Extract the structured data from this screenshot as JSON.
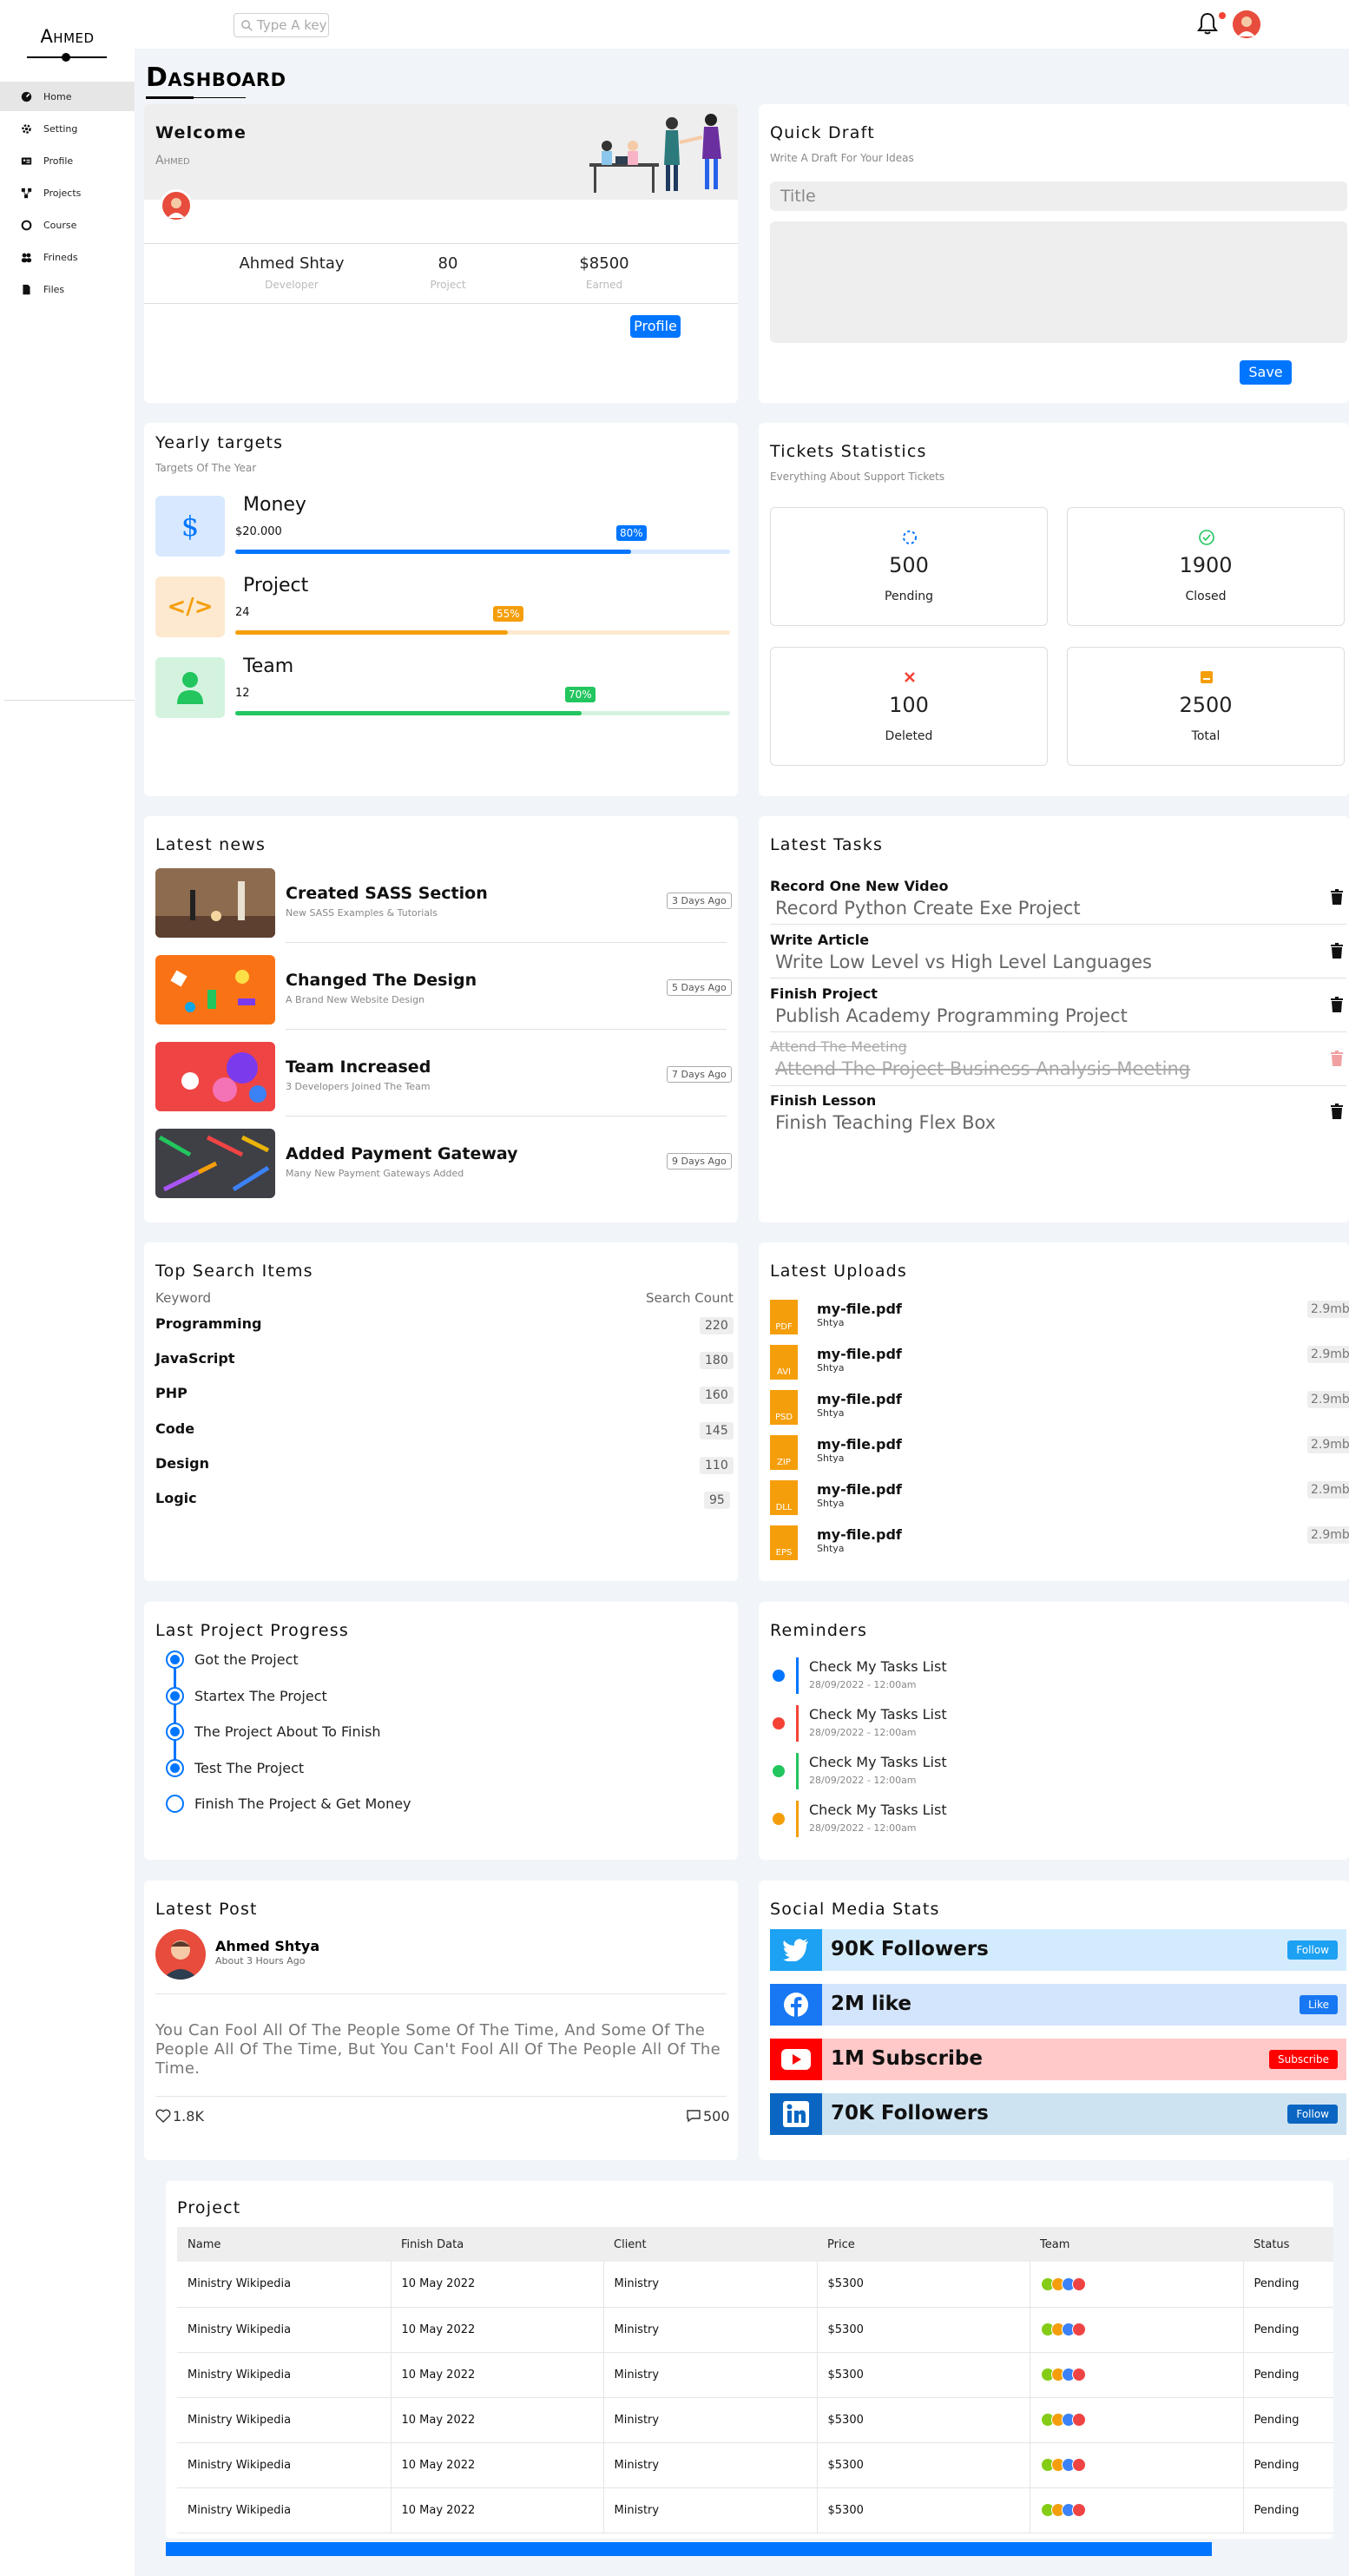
{
  "brand": "Ahmed",
  "sidebar": {
    "items": [
      {
        "label": "Home"
      },
      {
        "label": "Setting"
      },
      {
        "label": "Profile"
      },
      {
        "label": "Projects"
      },
      {
        "label": "Course"
      },
      {
        "label": "Frineds"
      },
      {
        "label": "Files"
      }
    ]
  },
  "header": {
    "search_placeholder": "Type A key"
  },
  "page_title": "Dashboard",
  "welcome": {
    "title": "Welcome",
    "name_small": "Ahmed",
    "stats": [
      {
        "value": "Ahmed Shtay",
        "label": "Developer"
      },
      {
        "value": "80",
        "label": "Project"
      },
      {
        "value": "$8500",
        "label": "Earned"
      }
    ],
    "button": "Profile"
  },
  "draft": {
    "title": "Quick Draft",
    "subtitle": "Write A Draft For Your Ideas",
    "title_placeholder": "Title",
    "button": "Save"
  },
  "targets": {
    "title": "Yearly targets",
    "subtitle": "Targets Of The Year",
    "items": [
      {
        "name": "Money",
        "value": "$20.000",
        "percent": 80,
        "badge": "80%",
        "color": "#0075ff",
        "track": "#d8e9ff",
        "bg": "#d8e9ff",
        "icon_glyph": "$"
      },
      {
        "name": "Project",
        "value": "24",
        "percent": 55,
        "badge": "55%",
        "color": "#f59e0b",
        "track": "#fde9cf",
        "bg": "#fde9cf",
        "icon_glyph": "</>"
      },
      {
        "name": "Team",
        "value": "12",
        "percent": 70,
        "badge": "70%",
        "color": "#22c55e",
        "track": "#d3f3df",
        "bg": "#d3f3df",
        "icon_glyph": "user"
      }
    ]
  },
  "tickets": {
    "title": "Tickets Statistics",
    "subtitle": "Everything About Support Tickets",
    "items": [
      {
        "num": "500",
        "label": "Pending"
      },
      {
        "num": "1900",
        "label": "Closed"
      },
      {
        "num": "100",
        "label": "Deleted"
      },
      {
        "num": "2500",
        "label": "Total"
      }
    ]
  },
  "news": {
    "title": "Latest news",
    "items": [
      {
        "title": "Created SASS Section",
        "sub": "New SASS Examples & Tutorials",
        "date": "3 Days Ago"
      },
      {
        "title": "Changed The Design",
        "sub": "A Brand New Website Design",
        "date": "5 Days Ago"
      },
      {
        "title": "Team Increased",
        "sub": "3 Developers Joined The Team",
        "date": "7 Days Ago"
      },
      {
        "title": "Added Payment Gateway",
        "sub": "Many New Payment Gateways Added",
        "date": "9 Days Ago"
      }
    ]
  },
  "tasks": {
    "title": "Latest Tasks",
    "items": [
      {
        "title": "Record One New Video",
        "sub": "Record Python Create Exe Project",
        "done": false
      },
      {
        "title": "Write Article",
        "sub": "Write Low Level vs High Level Languages",
        "done": false
      },
      {
        "title": "Finish Project",
        "sub": "Publish Academy Programming Project",
        "done": false
      },
      {
        "title": "Attend The Meeting",
        "sub": "Attend The Project Business Analysis Meeting",
        "done": true
      },
      {
        "title": "Finish Lesson",
        "sub": "Finish Teaching Flex Box",
        "done": false
      }
    ]
  },
  "search_items": {
    "title": "Top Search Items",
    "col1": "Keyword",
    "col2": "Search Count",
    "items": [
      {
        "k": "Programming",
        "c": "220"
      },
      {
        "k": "JavaScript",
        "c": "180"
      },
      {
        "k": "PHP",
        "c": "160"
      },
      {
        "k": "Code",
        "c": "145"
      },
      {
        "k": "Design",
        "c": "110"
      },
      {
        "k": "Logic",
        "c": "95"
      }
    ]
  },
  "uploads": {
    "title": "Latest Uploads",
    "items": [
      {
        "name": "my-file.pdf",
        "user": "Shtya",
        "size": "2.9mb",
        "ext": "PDF"
      },
      {
        "name": "my-file.pdf",
        "user": "Shtya",
        "size": "2.9mb",
        "ext": "AVI"
      },
      {
        "name": "my-file.pdf",
        "user": "Shtya",
        "size": "2.9mb",
        "ext": "PSD"
      },
      {
        "name": "my-file.pdf",
        "user": "Shtya",
        "size": "2.9mb",
        "ext": "ZIP"
      },
      {
        "name": "my-file.pdf",
        "user": "Shtya",
        "size": "2.9mb",
        "ext": "DLL"
      },
      {
        "name": "my-file.pdf",
        "user": "Shtya",
        "size": "2.9mb",
        "ext": "EPS"
      }
    ]
  },
  "progress": {
    "title": "Last Project Progress",
    "items": [
      {
        "text": "Got the Project",
        "done": true
      },
      {
        "text": "Startex The Project",
        "done": true
      },
      {
        "text": "The Project About To Finish",
        "done": true
      },
      {
        "text": "Test The Project",
        "done": true
      },
      {
        "text": "Finish The Project & Get Money",
        "done": false
      }
    ]
  },
  "reminders": {
    "title": "Reminders",
    "items": [
      {
        "text": "Check My Tasks List",
        "date": "28/09/2022 - 12:00am",
        "color": "#0075ff"
      },
      {
        "text": "Check My Tasks List",
        "date": "28/09/2022 - 12:00am",
        "color": "#f44336"
      },
      {
        "text": "Check My Tasks List",
        "date": "28/09/2022 - 12:00am",
        "color": "#22c55e"
      },
      {
        "text": "Check My Tasks List",
        "date": "28/09/2022 - 12:00am",
        "color": "#f59e0b"
      }
    ]
  },
  "post": {
    "title": "Latest Post",
    "author": "Ahmed Shtya",
    "time": "About 3 Hours Ago",
    "body": "You Can Fool All Of The People Some Of The Time, And Some Of The People All Of The Time, But You Can't Fool All Of The People All Of The Time.",
    "likes": "1.8K",
    "comments": "500"
  },
  "social": {
    "title": "Social Media Stats",
    "items": [
      {
        "text": "90K Followers",
        "btn": "Follow",
        "color": "#1da1f2",
        "bg": "#d3ecfd",
        "icon": "twitter"
      },
      {
        "text": "2M like",
        "btn": "Like",
        "color": "#1877f2",
        "bg": "#d3e4fd",
        "icon": "facebook"
      },
      {
        "text": "1M Subscribe",
        "btn": "Subscribe",
        "color": "#ff0000",
        "bg": "#ffc9c9",
        "icon": "youtube"
      },
      {
        "text": "70K Followers",
        "btn": "Follow",
        "color": "#0a66c2",
        "bg": "#cde3f1",
        "icon": "linkedin"
      }
    ]
  },
  "projects": {
    "title": "Project",
    "headers": [
      "Name",
      "Finish Data",
      "Client",
      "Price",
      "Team",
      "Status"
    ],
    "rows": [
      [
        "Ministry Wikipedia",
        "10 May 2022",
        "Ministry",
        "$5300",
        "",
        "Pending"
      ],
      [
        "Ministry Wikipedia",
        "10 May 2022",
        "Ministry",
        "$5300",
        "",
        "Pending"
      ],
      [
        "Ministry Wikipedia",
        "10 May 2022",
        "Ministry",
        "$5300",
        "",
        "Pending"
      ],
      [
        "Ministry Wikipedia",
        "10 May 2022",
        "Ministry",
        "$5300",
        "",
        "Pending"
      ],
      [
        "Ministry Wikipedia",
        "10 May 2022",
        "Ministry",
        "$5300",
        "",
        "Pending"
      ],
      [
        "Ministry Wikipedia",
        "10 May 2022",
        "Ministry",
        "$5300",
        "",
        "Pending"
      ]
    ]
  },
  "colors": {
    "accent": "#0075ff",
    "background": "#f1f5f9"
  }
}
